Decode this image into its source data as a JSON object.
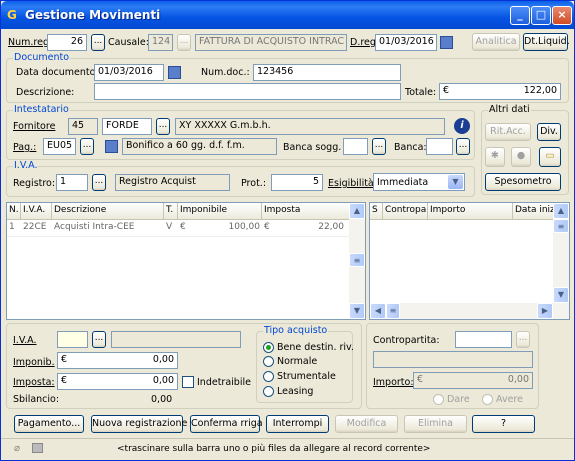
{
  "window": {
    "app_glyph": "G",
    "title": "Gestione Movimenti",
    "min": "_",
    "max": "□",
    "close": "×"
  },
  "top": {
    "num_reg_label": "Num.reg.",
    "num_reg_value": "26",
    "causale_label": "Causale:",
    "causale_code": "124",
    "causale_desc": "FATTURA DI ACQUISTO INTRAC",
    "data_reg_label": "D.reg.",
    "data_reg_value": "01/03/2016",
    "analitica": "Analitica",
    "dt_liquid": "Dt.Liquid."
  },
  "documento": {
    "title": "Documento",
    "data_label": "Data documento:",
    "data_value": "01/03/2016",
    "num_label": "Num.doc.:",
    "num_value": "123456",
    "descr_label": "Descrizione:",
    "descr_value": "",
    "totale_label": "Totale:",
    "totale_currency": "€",
    "totale_value": "122,00"
  },
  "intestatario": {
    "title": "Intestatario",
    "fornitore_label": "Fornitore",
    "fornitore_num": "45",
    "fornitore_code": "FORDE",
    "fornitore_name": "XY XXXXX G.m.b.h.",
    "pag_label": "Pag.:",
    "pag_code": "EU05",
    "pag_desc": "Bonifico a 60 gg. d.f. f.m.",
    "banca_sogg_label": "Banca sogg.",
    "banca_label": "Banca:"
  },
  "altri_dati": {
    "title": "Altri dati",
    "rit_acc": "Rit.Acc.",
    "div": "Div.",
    "spesometro": "Spesometro"
  },
  "iva": {
    "title": "I.V.A.",
    "registro_label": "Registro:",
    "registro_num": "1",
    "registro_desc": "Registro Acquist",
    "prot_label": "Prot.:",
    "prot_value": "5",
    "esig_label": "Esigibilità:",
    "esig_value": "Immediata"
  },
  "grid_left": {
    "headers": [
      "N.",
      "I.V.A.",
      "Descrizione",
      "T.",
      "Imponibile",
      "Imposta"
    ],
    "rows": [
      {
        "n": "1",
        "iva": "22CE",
        "descr": "Acquisti Intra-CEE",
        "t": "V",
        "cur1": "€",
        "imponibile": "100,00",
        "cur2": "€",
        "imposta": "22,00"
      }
    ]
  },
  "grid_right": {
    "headers": [
      "S",
      "Contropartita",
      "Importo",
      "Data inizio"
    ]
  },
  "bottom_left": {
    "iva_label": "I.V.A.",
    "imponib_label": "Imponib.",
    "imponib_currency": "€",
    "imponib_value": "0,00",
    "imposta_label": "Imposta:",
    "imposta_currency": "€",
    "imposta_value": "0,00",
    "indetraibile_label": "Indetraibile",
    "sbilancio_label": "Sbilancio:",
    "sbilancio_value": "0,00"
  },
  "tipo_acquisto": {
    "title": "Tipo acquisto",
    "options": [
      "Bene destin. riv.",
      "Normale",
      "Strumentale",
      "Leasing"
    ],
    "selected": 0
  },
  "bottom_right": {
    "contropartita_label": "Contropartita:",
    "importo_label": "Importo:",
    "importo_currency": "€",
    "importo_value": "0,00",
    "dare": "Dare",
    "avere": "Avere"
  },
  "buttons": {
    "pagamento": "Pagamento...",
    "nuova": "Nuova registrazione",
    "conferma": "Conferma rriga",
    "interrompi": "Interrompi",
    "modifica": "Modifica",
    "elimina": "Elimina",
    "help": "?"
  },
  "status": {
    "hint": "<trascinare sulla barra uno o più files da allegare al record corrente>"
  }
}
